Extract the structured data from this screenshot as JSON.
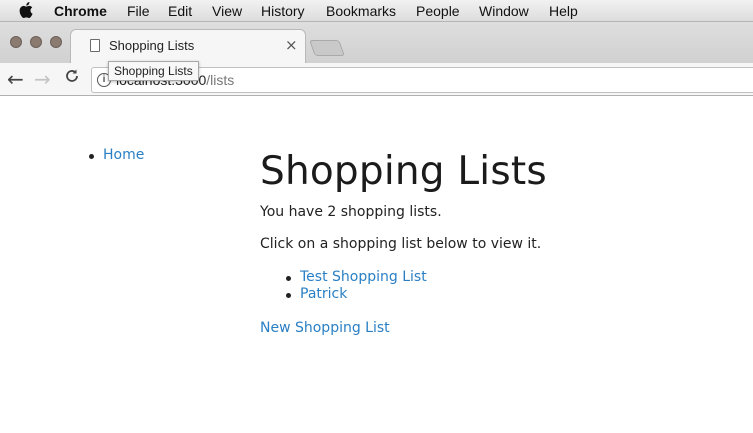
{
  "menubar": {
    "app": "Chrome",
    "items": [
      "File",
      "Edit",
      "View",
      "History",
      "Bookmarks",
      "People",
      "Window",
      "Help"
    ]
  },
  "tab": {
    "title": "Shopping Lists",
    "close": "×"
  },
  "toolbar": {
    "back": "←",
    "forward": "→",
    "reload": "C",
    "info": "i",
    "url_host": "localhost:3000",
    "url_path": "/lists"
  },
  "tooltip": "Shopping Lists",
  "nav": {
    "home": "Home"
  },
  "main": {
    "title": "Shopping Lists",
    "count_text": "You have 2 shopping lists.",
    "instruction": "Click on a shopping list below to view it.",
    "lists": [
      "Test Shopping List",
      "Patrick"
    ],
    "new_link": "New Shopping List"
  },
  "colors": {
    "link": "#2a7fc4",
    "menubar": "#e6e6e6",
    "window_chrome": "#d6d6d6"
  }
}
